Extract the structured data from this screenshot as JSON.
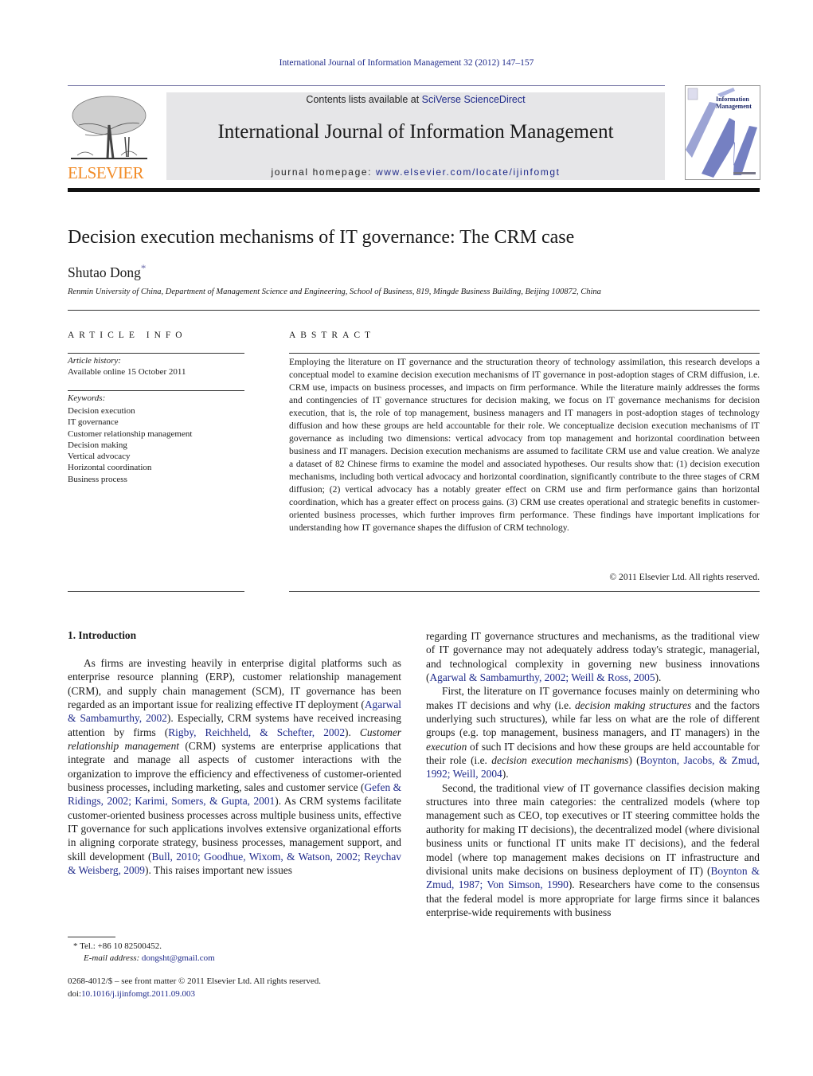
{
  "running_head": "International Journal of Information Management 32 (2012) 147–157",
  "masthead": {
    "publisher_logo_text": "ELSEVIER",
    "contents_prefix": "Contents lists available at ",
    "contents_link": "SciVerse ScienceDirect",
    "journal_title": "International Journal of Information Management",
    "homepage_prefix": "journal homepage: ",
    "homepage_link": "www.elsevier.com/locate/ijinfomgt",
    "cover_title_line1": "Information",
    "cover_title_line2": "Management",
    "colors": {
      "publisher_orange": "#f28c28",
      "link_blue": "#1f2a8a",
      "masthead_gray": "#e6e6e8"
    }
  },
  "article": {
    "title": "Decision execution mechanisms of IT governance: The CRM case",
    "author": "Shutao Dong",
    "author_mark": "*",
    "affiliation": "Renmin University of China, Department of Management Science and Engineering, School of Business, 819, Mingde Business Building, Beijing 100872, China"
  },
  "article_info": {
    "heading": "ARTICLE INFO",
    "history_label": "Article history:",
    "history_value": "Available online 15 October 2011",
    "keywords_label": "Keywords:",
    "keywords": [
      "Decision execution",
      "IT governance",
      "Customer relationship management",
      "Decision making",
      "Vertical advocacy",
      "Horizontal coordination",
      "Business process"
    ]
  },
  "abstract": {
    "heading": "ABSTRACT",
    "text": "Employing the literature on IT governance and the structuration theory of technology assimilation, this research develops a conceptual model to examine decision execution mechanisms of IT governance in post-adoption stages of CRM diffusion, i.e. CRM use, impacts on business processes, and impacts on firm performance. While the literature mainly addresses the forms and contingencies of IT governance structures for decision making, we focus on IT governance mechanisms for decision execution, that is, the role of top management, business managers and IT managers in post-adoption stages of technology diffusion and how these groups are held accountable for their role. We conceptualize decision execution mechanisms of IT governance as including two dimensions: vertical advocacy from top management and horizontal coordination between business and IT managers. Decision execution mechanisms are assumed to facilitate CRM use and value creation. We analyze a dataset of 82 Chinese firms to examine the model and associated hypotheses. Our results show that: (1) decision execution mechanisms, including both vertical advocacy and horizontal coordination, significantly contribute to the three stages of CRM diffusion; (2) vertical advocacy has a notably greater effect on CRM use and firm performance gains than horizontal coordination, which has a greater effect on process gains. (3) CRM use creates operational and strategic benefits in customer-oriented business processes, which further improves firm performance. These findings have important implications for understanding how IT governance shapes the diffusion of CRM technology.",
    "copyright": "© 2011 Elsevier Ltd. All rights reserved."
  },
  "body": {
    "intro_heading": "1.  Introduction",
    "left": {
      "p1_a": "As firms are investing heavily in enterprise digital platforms such as enterprise resource planning (ERP), customer relationship management (CRM), and supply chain management (SCM), IT governance has been regarded as an important issue for realizing effective IT deployment (",
      "p1_cite1": "Agarwal & Sambamurthy, 2002",
      "p1_b": "). Especially, CRM systems have received increasing attention by firms (",
      "p1_cite2": "Rigby, Reichheld, & Schefter, 2002",
      "p1_c": "). ",
      "p1_italic": "Customer relationship management",
      "p1_d": " (CRM) systems are enterprise applications that integrate and manage all aspects of customer interactions with the organization to improve the efficiency and effectiveness of customer-oriented business processes, including marketing, sales and customer service (",
      "p1_cite3": "Gefen & Ridings, 2002; Karimi, Somers, & Gupta, 2001",
      "p1_e": "). As CRM systems facilitate customer-oriented business processes across multiple business units, effective IT governance for such applications involves extensive organizational efforts in aligning corporate strategy, business processes, management support, and skill development (",
      "p1_cite4": "Bull, 2010; Goodhue, Wixom, & Watson, 2002; Reychav & Weisberg, 2009",
      "p1_f": "). This raises important new issues"
    },
    "right": {
      "p0_a": "regarding IT governance structures and mechanisms, as the traditional view of IT governance may not adequately address today's strategic, managerial, and technological complexity in governing new business innovations (",
      "p0_cite": "Agarwal & Sambamurthy, 2002; Weill & Ross, 2005",
      "p0_b": ").",
      "p1_a": "First, the literature on IT governance focuses mainly on determining who makes IT decisions and why (i.e. ",
      "p1_italic1": "decision making structures",
      "p1_b": " and the factors underlying such structures), while far less on what are the role of different groups (e.g. top management, business managers, and IT managers) in the ",
      "p1_italic2": "execution",
      "p1_c": " of such IT decisions and how these groups are held accountable for their role (i.e. ",
      "p1_italic3": "decision execution mechanisms",
      "p1_d": ") (",
      "p1_cite": "Boynton, Jacobs, & Zmud, 1992; Weill, 2004",
      "p1_e": ").",
      "p2_a": "Second, the traditional view of IT governance classifies decision making structures into three main categories: the centralized models (where top management such as CEO, top executives or IT steering committee holds the authority for making IT decisions), the decentralized model (where divisional business units or functional IT units make IT decisions), and the federal model (where top management makes decisions on IT infrastructure and divisional units make decisions on business deployment of IT) (",
      "p2_cite": "Boynton & Zmud, 1987; Von Simson, 1990",
      "p2_b": "). Researchers have come to the consensus that the federal model is more appropriate for large firms since it balances enterprise-wide requirements with business"
    }
  },
  "footnote": {
    "mark": "*",
    "tel": "Tel.: +86 10 82500452.",
    "email_label": "E-mail address: ",
    "email": "dongsht@gmail.com"
  },
  "front_matter": {
    "issn_line": "0268-4012/$ – see front matter © 2011 Elsevier Ltd. All rights reserved.",
    "doi_prefix": "doi:",
    "doi": "10.1016/j.ijinfomgt.2011.09.003"
  }
}
